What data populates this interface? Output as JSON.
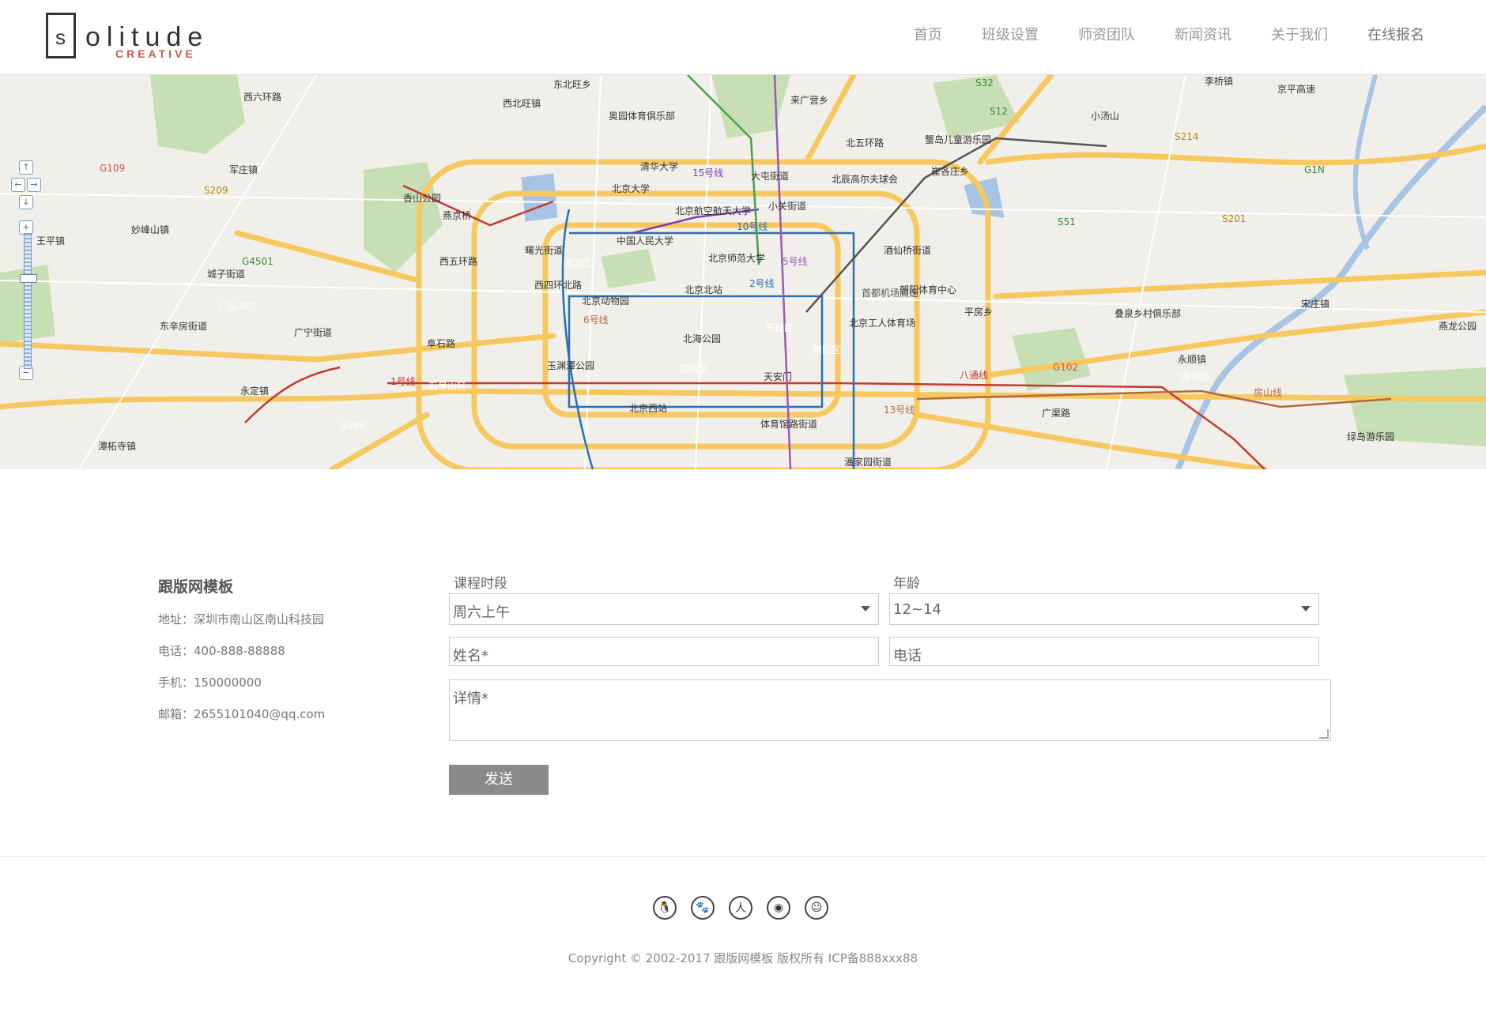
{
  "logo": {
    "letter": "s",
    "rest": "olitude",
    "sub": "CREATIVE"
  },
  "nav": [
    "首页",
    "班级设置",
    "师资团队",
    "新闻资讯",
    "关于我们",
    "在线报名"
  ],
  "map": {
    "labels": [
      "东北旺乡",
      "西北旺镇",
      "奥园体育俱乐部",
      "来广营乡",
      "北五环路",
      "西六环路",
      "军庄镇",
      "香山公园",
      "清华大学",
      "北京大学",
      "15号线",
      "大屯街道",
      "北辰高尔夫球会",
      "蟹岛儿童游乐园",
      "崔各庄乡",
      "妙峰山镇",
      "北京航空航天大学",
      "小关街道",
      "10号线",
      "王平镇",
      "中国人民大学",
      "曙光街道",
      "海淀区",
      "北京师范大学",
      "酒仙桥街道",
      "城子街道",
      "西五环路",
      "西四环北路",
      "北京北站",
      "2号线",
      "朝阳体育中心",
      "叠泉乡村俱乐部",
      "宋庄镇",
      "门头沟区",
      "北京动物园",
      "平房乡",
      "东辛房街道",
      "广宁街道",
      "6号线",
      "北京工人体育场",
      "东城区",
      "燕龙公园",
      "阜石路",
      "北海公园",
      "朝阳区",
      "永顺镇",
      "玉渊潭公园",
      "西城区",
      "天安门",
      "八通线",
      "通州区",
      "1号线",
      "石景山区",
      "永定镇",
      "北京西站",
      "广渠路",
      "G108",
      "体育馆路街道",
      "绿岛游乐园",
      "潭柘寺镇",
      "潘家园街道",
      "京平高速",
      "李桥镇",
      "G1N",
      "S12",
      "S32",
      "S51",
      "G4501",
      "G109",
      "S209",
      "S201",
      "S214",
      "G102",
      "5号线",
      "13号线",
      "首都机场高速",
      "房山线",
      "燕京桥",
      "小汤山"
    ]
  },
  "contact": {
    "company": "跟版网模板",
    "address": "地址：深圳市南山区南山科技园",
    "phone": "电话：400-888-88888",
    "mobile": "手机：150000000",
    "email": "邮箱：2655101040@qq.com"
  },
  "form": {
    "course_label": "课程时段",
    "course_value": "周六上午",
    "age_label": "年龄",
    "age_value": "12~14",
    "name_placeholder": "姓名*",
    "phone_placeholder": "电话",
    "details_placeholder": "详情*",
    "send_label": "发送"
  },
  "socials": [
    "qq-icon",
    "baidu-icon",
    "renren-icon",
    "weibo-icon",
    "wechat-icon"
  ],
  "social_glyphs": [
    "🐧",
    "🐾",
    "人",
    "◉",
    "☺"
  ],
  "copyright": "Copyright © 2002-2017 跟版网模板 版权所有 ICP备888xxx88",
  "colors": {
    "brand_sub": "#c85a48",
    "button": "#8a8a8a",
    "map_bg": "#f1efe9",
    "road": "#f6c85f",
    "park": "#c7dfb4",
    "water": "#a7c4e5"
  }
}
